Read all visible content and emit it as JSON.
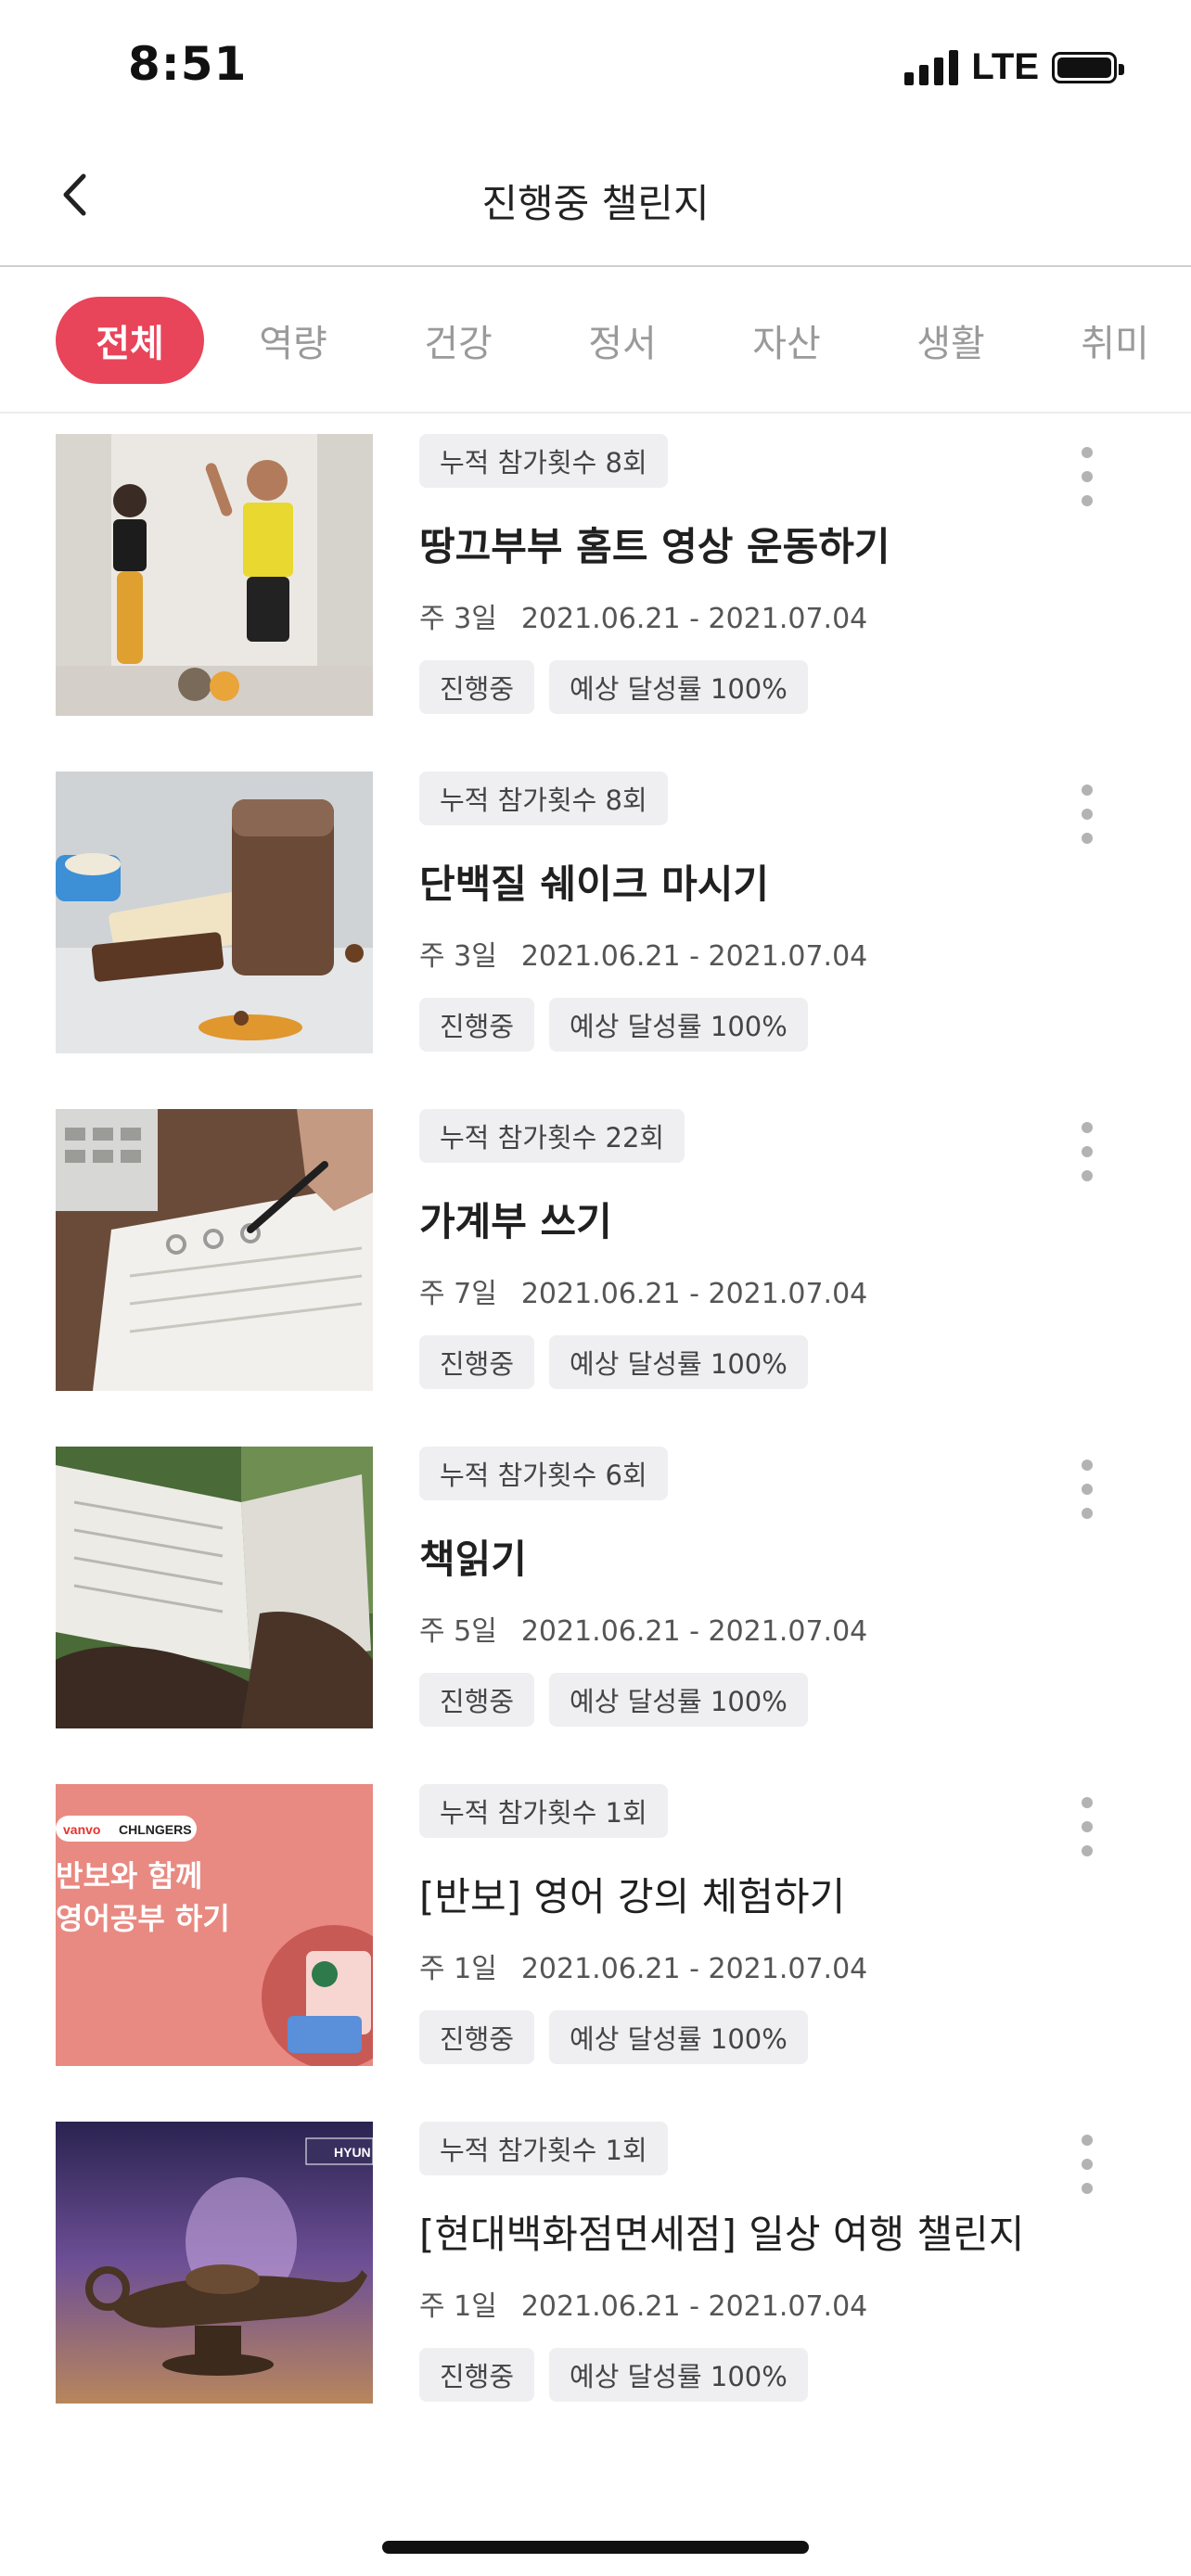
{
  "status_bar": {
    "time": "8:51",
    "network": "LTE"
  },
  "header": {
    "title": "진행중 챌린지",
    "back_icon": "chevron-left-icon"
  },
  "tabs": [
    {
      "label": "전체",
      "active": true
    },
    {
      "label": "역량",
      "active": false
    },
    {
      "label": "건강",
      "active": false
    },
    {
      "label": "정서",
      "active": false
    },
    {
      "label": "자산",
      "active": false
    },
    {
      "label": "생활",
      "active": false
    },
    {
      "label": "취미",
      "active": false
    }
  ],
  "challenges": [
    {
      "participation": "누적 참가횟수 8회",
      "title": "땅끄부부 홈트 영상 운동하기",
      "frequency": "주 3일",
      "period": "2021.06.21 - 2021.07.04",
      "status": "진행중",
      "expected": "예상 달성률 100%",
      "image": "home-workout-couple"
    },
    {
      "participation": "누적 참가횟수 8회",
      "title": "단백질 쉐이크 마시기",
      "frequency": "주 3일",
      "period": "2021.06.21 - 2021.07.04",
      "status": "진행중",
      "expected": "예상 달성률 100%",
      "image": "protein-shake"
    },
    {
      "participation": "누적 참가횟수 22회",
      "title": "가계부 쓰기",
      "frequency": "주 7일",
      "period": "2021.06.21 - 2021.07.04",
      "status": "진행중",
      "expected": "예상 달성률 100%",
      "image": "notebook-calculator"
    },
    {
      "participation": "누적 참가횟수 6회",
      "title": "책읽기",
      "frequency": "주 5일",
      "period": "2021.06.21 - 2021.07.04",
      "status": "진행중",
      "expected": "예상 달성률 100%",
      "image": "open-book"
    },
    {
      "participation": "누적 참가횟수 1회",
      "title": "[반보] 영어 강의 체험하기",
      "frequency": "주 1일",
      "period": "2021.06.21 - 2021.07.04",
      "status": "진행중",
      "expected": "예상 달성률 100%",
      "image": "banbo-banner",
      "image_text": {
        "brand": "vanvo",
        "partner": "CHLNGERS",
        "line1": "반보와 함께",
        "line2": "영어공부 하기"
      }
    },
    {
      "participation": "누적 참가횟수 1회",
      "title": "[현대백화점면세점] 일상 여행 챌린지",
      "frequency": "주 1일",
      "period": "2021.06.21 - 2021.07.04",
      "status": "진행중",
      "expected": "예상 달성률 100%",
      "image": "magic-lamp",
      "image_text": {
        "brand": "HYUN"
      }
    }
  ],
  "colors": {
    "accent": "#e8445a",
    "pill_bg": "#efeff1",
    "dots": "#b3b3b3"
  }
}
